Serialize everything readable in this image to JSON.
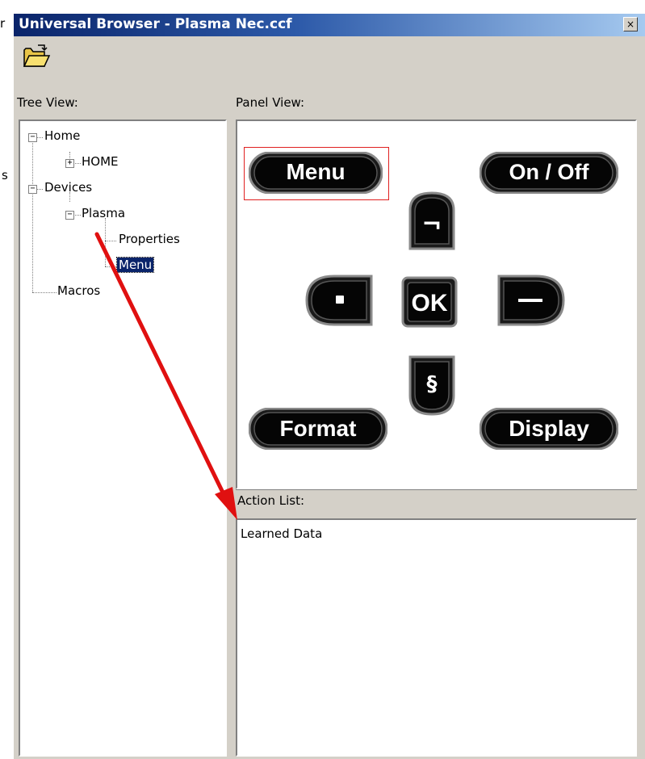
{
  "window": {
    "title": "Universal Browser - Plasma Nec.ccf",
    "close_glyph": "×"
  },
  "toolbar": {
    "open_icon": "folder-open-icon"
  },
  "stray_text": [
    "r",
    "s"
  ],
  "tree": {
    "label": "Tree View:",
    "toggles": {
      "collapse": "−",
      "expand": "+"
    },
    "nodes": {
      "home": "Home",
      "home_child": "HOME",
      "devices": "Devices",
      "plasma": "Plasma",
      "properties": "Properties",
      "menu": "Menu",
      "macros": "Macros"
    },
    "selected": "Menu"
  },
  "panel": {
    "label": "Panel View:",
    "buttons": {
      "menu": "Menu",
      "onoff": "On / Off",
      "format": "Format",
      "display": "Display",
      "ok": "OK",
      "up_glyph": "¬",
      "down_glyph": "§"
    },
    "selected_button": "Menu"
  },
  "action_list": {
    "label": "Action List:",
    "items": [
      "Learned Data"
    ]
  },
  "colors": {
    "title_start": "#0a246a",
    "title_end": "#a6caf0",
    "arrow": "#e01010",
    "selection_frame": "#e02020"
  }
}
